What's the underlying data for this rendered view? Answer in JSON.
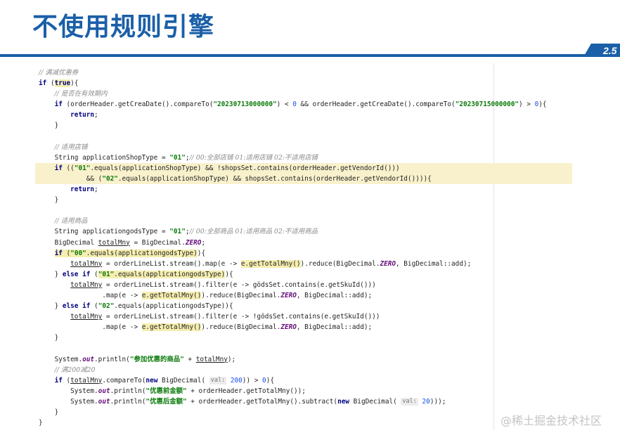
{
  "slide": {
    "title": "不使用规则引擎",
    "page_number": "2.5",
    "brand_color": "#1a5fa8"
  },
  "code_lines": [
    [
      {
        "t": "// 满减优惠券",
        "c": "cmt"
      }
    ],
    [
      {
        "t": "if",
        "c": "kw"
      },
      {
        "t": " ("
      },
      {
        "t": "true",
        "c": "kw hl"
      },
      {
        "t": "){"
      }
    ],
    [
      {
        "t": "    "
      },
      {
        "t": "// 是否在有效期内",
        "c": "cmt"
      }
    ],
    [
      {
        "t": "    "
      },
      {
        "t": "if",
        "c": "kw"
      },
      {
        "t": " (orderHeader.getCreaDate().compareTo("
      },
      {
        "t": "\"20230713000000\"",
        "c": "str"
      },
      {
        "t": ") < "
      },
      {
        "t": "0",
        "c": "num"
      },
      {
        "t": " && orderHeader.getCreaDate().compareTo("
      },
      {
        "t": "\"20230715000000\"",
        "c": "str"
      },
      {
        "t": ") > "
      },
      {
        "t": "0",
        "c": "num"
      },
      {
        "t": "){"
      }
    ],
    [
      {
        "t": "        "
      },
      {
        "t": "return",
        "c": "kw"
      },
      {
        "t": ";"
      }
    ],
    [
      {
        "t": "    }"
      }
    ],
    [
      {
        "t": ""
      }
    ],
    [
      {
        "t": "    "
      },
      {
        "t": "// 适用店铺",
        "c": "cmt"
      }
    ],
    [
      {
        "t": "    String applicationShopType = "
      },
      {
        "t": "\"01\"",
        "c": "str"
      },
      {
        "t": ";"
      },
      {
        "t": "// 00:全部店铺 01:适用店铺 02:不适用店铺",
        "c": "cmt"
      }
    ],
    [
      {
        "t": "    "
      },
      {
        "t": "if",
        "c": "kw"
      },
      {
        "t": " (("
      },
      {
        "t": "\"01\"",
        "c": "str"
      },
      {
        "t": ".equals(applicationShopType) && !shopsSet.contains(orderHeader.getVendorId()))"
      }
    ],
    [
      {
        "t": "            && ("
      },
      {
        "t": "\"02\"",
        "c": "str"
      },
      {
        "t": ".equals(applicationShopType) && shopsSet.contains(orderHeader.getVendorId()))){"
      }
    ],
    [
      {
        "t": "        "
      },
      {
        "t": "return",
        "c": "kw"
      },
      {
        "t": ";"
      }
    ],
    [
      {
        "t": "    }"
      }
    ],
    [
      {
        "t": ""
      }
    ],
    [
      {
        "t": "    "
      },
      {
        "t": "// 适用商品",
        "c": "cmt"
      }
    ],
    [
      {
        "t": "    String applicationgodsType = "
      },
      {
        "t": "\"01\"",
        "c": "str"
      },
      {
        "t": ";"
      },
      {
        "t": "// 00:全部商品 01:适用商品 02:不适用商品",
        "c": "cmt"
      }
    ],
    [
      {
        "t": "    BigDecimal "
      },
      {
        "t": "totalMny",
        "c": "var"
      },
      {
        "t": " = BigDecimal."
      },
      {
        "t": "ZERO",
        "c": "fld"
      },
      {
        "t": ";"
      }
    ],
    [
      {
        "t": "    "
      },
      {
        "t": "if",
        "c": "kw hl"
      },
      {
        "t": " (",
        "c": "hl"
      },
      {
        "t": "\"00\"",
        "c": "str hl"
      },
      {
        "t": ".equals(applicationgodsType)",
        "c": "hl"
      },
      {
        "t": "){"
      }
    ],
    [
      {
        "t": "        "
      },
      {
        "t": "totalMny",
        "c": "var"
      },
      {
        "t": " = orderLineList.stream().map(e -> "
      },
      {
        "t": "e.getTotalMny()",
        "c": "hl"
      },
      {
        "t": ").reduce(BigDecimal."
      },
      {
        "t": "ZERO",
        "c": "fld"
      },
      {
        "t": ", BigDecimal::add);"
      }
    ],
    [
      {
        "t": "    } "
      },
      {
        "t": "else if",
        "c": "kw"
      },
      {
        "t": " ("
      },
      {
        "t": "\"01\"",
        "c": "str hl"
      },
      {
        "t": ".equals(applicationgodsType)",
        "c": "hl"
      },
      {
        "t": "){"
      }
    ],
    [
      {
        "t": "        "
      },
      {
        "t": "totalMny",
        "c": "var"
      },
      {
        "t": " = orderLineList.stream().filter(e -> gödsSet.contains(e.getSkuId()))"
      }
    ],
    [
      {
        "t": "                .map(e -> "
      },
      {
        "t": "e.getTotalMny()",
        "c": "hl"
      },
      {
        "t": ").reduce(BigDecimal."
      },
      {
        "t": "ZERO",
        "c": "fld"
      },
      {
        "t": ", BigDecimal::add);"
      }
    ],
    [
      {
        "t": "    } "
      },
      {
        "t": "else if",
        "c": "kw"
      },
      {
        "t": " ("
      },
      {
        "t": "\"02\"",
        "c": "str"
      },
      {
        "t": ".equals(applicationgodsType)){"
      }
    ],
    [
      {
        "t": "        "
      },
      {
        "t": "totalMny",
        "c": "var"
      },
      {
        "t": " = orderLineList.stream().filter(e -> !gödsSet.contains(e.getSkuId()))"
      }
    ],
    [
      {
        "t": "                .map(e -> "
      },
      {
        "t": "e.getTotalMny()",
        "c": "hl"
      },
      {
        "t": ").reduce(BigDecimal."
      },
      {
        "t": "ZERO",
        "c": "fld"
      },
      {
        "t": ", BigDecimal::add);"
      }
    ],
    [
      {
        "t": "    }"
      }
    ],
    [
      {
        "t": ""
      }
    ],
    [
      {
        "t": "    System."
      },
      {
        "t": "out",
        "c": "fld"
      },
      {
        "t": ".println("
      },
      {
        "t": "\"参加优惠的商品\"",
        "c": "str"
      },
      {
        "t": " + "
      },
      {
        "t": "totalMny",
        "c": "var"
      },
      {
        "t": ");"
      }
    ],
    [
      {
        "t": "    "
      },
      {
        "t": "// 满200减20",
        "c": "cmt"
      }
    ],
    [
      {
        "t": "    "
      },
      {
        "t": "if",
        "c": "kw"
      },
      {
        "t": " ("
      },
      {
        "t": "totalMny",
        "c": "var"
      },
      {
        "t": ".compareTo("
      },
      {
        "t": "new",
        "c": "kw"
      },
      {
        "t": " BigDecimal( "
      },
      {
        "t": "val:",
        "c": "hint"
      },
      {
        "t": " 200",
        "c": "num"
      },
      {
        "t": ")) > "
      },
      {
        "t": "0",
        "c": "num"
      },
      {
        "t": "){"
      }
    ],
    [
      {
        "t": "        System."
      },
      {
        "t": "out",
        "c": "fld"
      },
      {
        "t": ".println("
      },
      {
        "t": "\"优惠前金额\"",
        "c": "str"
      },
      {
        "t": " + orderHeader.getTotalMny());"
      }
    ],
    [
      {
        "t": "        System."
      },
      {
        "t": "out",
        "c": "fld"
      },
      {
        "t": ".println("
      },
      {
        "t": "\"优惠后金额\"",
        "c": "str"
      },
      {
        "t": " + orderHeader.getTotalMny().subtract("
      },
      {
        "t": "new",
        "c": "kw"
      },
      {
        "t": " BigDecimal( "
      },
      {
        "t": "val:",
        "c": "hint"
      },
      {
        "t": " 20",
        "c": "num"
      },
      {
        "t": ")));"
      }
    ],
    [
      {
        "t": "    }"
      }
    ],
    [
      {
        "t": "}"
      }
    ]
  ],
  "highlighted_lines": [
    9,
    10
  ],
  "watermark": "@稀土掘金技术社区"
}
